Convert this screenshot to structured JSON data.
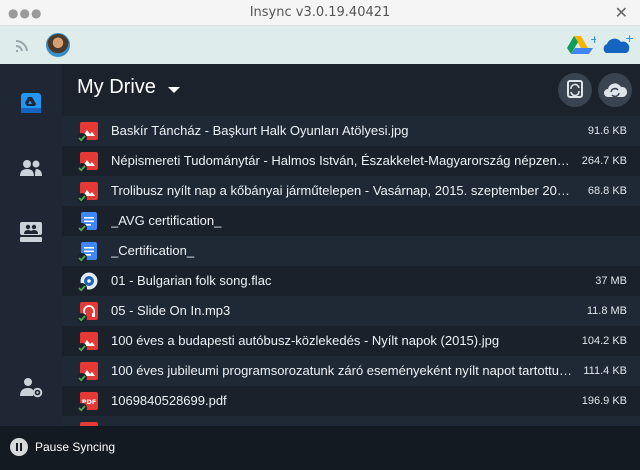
{
  "window": {
    "title": "Insync v3.0.19.40421",
    "close_glyph": "✕",
    "dots": "●●●"
  },
  "toolbar": {
    "icons": [
      "wifi-icon",
      "avatar",
      "google-drive-add-icon",
      "onedrive-add-icon"
    ]
  },
  "sidebar": {
    "items": [
      "google-drive-icon",
      "shared-icon",
      "drives-icon",
      "account-settings-icon"
    ]
  },
  "main": {
    "title": "My Drive",
    "files": [
      {
        "name": "Baskír Táncház - Başkurt Halk Oyunları Atölyesi.jpg",
        "size": "91.6 KB",
        "type": "image"
      },
      {
        "name": "Népismereti Tudománytár - Halmos István, Északkelet-Magyarország népzenéje…",
        "size": "264.7 KB",
        "type": "image"
      },
      {
        "name": "Trolibusz nyílt nap a kőbányai járműtelepen - Vasárnap, 2015. szeptember 20…",
        "size": "68.8 KB",
        "type": "image"
      },
      {
        "name": "_AVG certification_",
        "size": "",
        "type": "doc"
      },
      {
        "name": "_Certification_",
        "size": "",
        "type": "doc"
      },
      {
        "name": "01 - Bulgarian folk song.flac",
        "size": "37 MB",
        "type": "flac"
      },
      {
        "name": "05 - Slide On In.mp3",
        "size": "11.8 MB",
        "type": "audio"
      },
      {
        "name": "100 éves a budapesti autóbusz-közlekedés - Nyílt napok (2015).jpg",
        "size": "104.2 KB",
        "type": "image"
      },
      {
        "name": "100 éves jubileumi programsorozatunk záró eseményeként nyílt napot tartottunk…",
        "size": "111.4 KB",
        "type": "image"
      },
      {
        "name": "1069840528699.pdf",
        "size": "196.9 KB",
        "type": "pdf"
      },
      {
        "name": "",
        "size": "",
        "type": "image"
      }
    ]
  },
  "status": {
    "pause_label": "Pause Syncing"
  },
  "colors": {
    "accent": "#2196f3",
    "sync_ok": "#4caf50",
    "image_red": "#e53935",
    "doc_blue": "#4285f4"
  }
}
